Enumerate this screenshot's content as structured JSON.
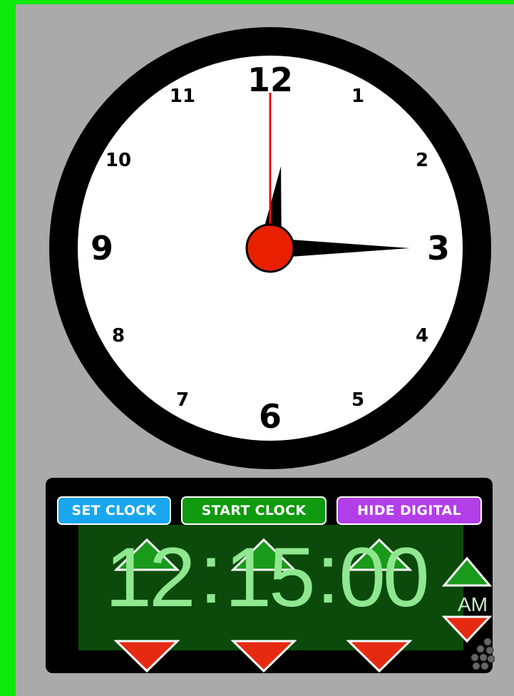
{
  "clock": {
    "numerals": [
      "12",
      "1",
      "2",
      "3",
      "4",
      "5",
      "6",
      "7",
      "8",
      "9",
      "10",
      "11"
    ],
    "time": {
      "hour": 12,
      "minute": 15,
      "second": 0
    },
    "colors": {
      "face": "#ffffff",
      "rim": "#000000",
      "hands": "#000000",
      "second_hand": "#e81010",
      "hub": "#e82000"
    }
  },
  "controls": {
    "set_clock_label": "SET CLOCK",
    "start_clock_label": "START CLOCK",
    "hide_digital_label": "HIDE DIGITAL",
    "set_clock_color": "#1aa6ee",
    "start_clock_color": "#0f9a0f",
    "hide_digital_color": "#b23ee8"
  },
  "digital": {
    "hours": "12",
    "minutes": "15",
    "seconds": "00",
    "separator": ":",
    "ampm": "AM",
    "up_color": "#1a9a1a",
    "down_color": "#e62a12"
  }
}
